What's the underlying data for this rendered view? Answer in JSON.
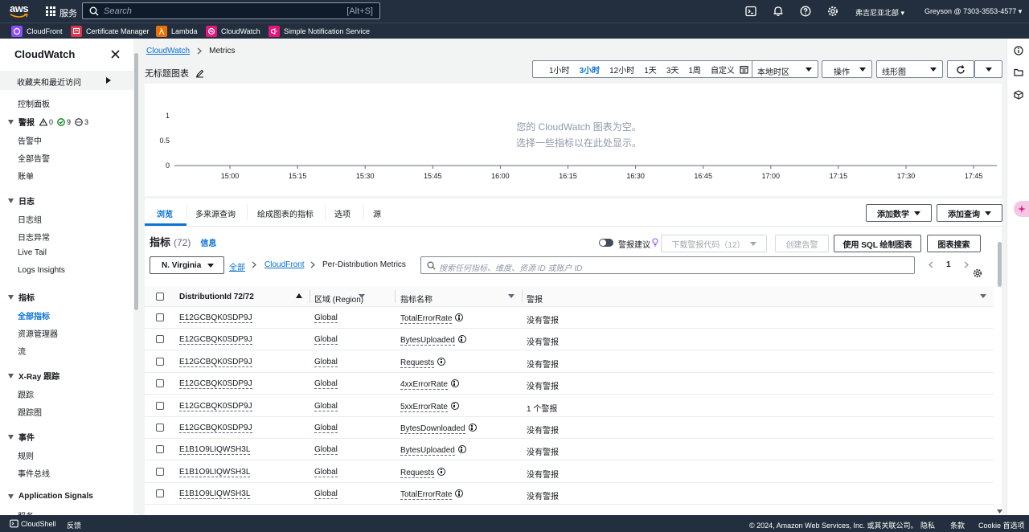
{
  "topbar": {
    "logo_text": "aws",
    "services_label": "服务",
    "search_placeholder": "Search",
    "search_shortcut": "[Alt+S]",
    "region": "弗吉尼亚北部",
    "account": "Greyson @ 7303-3553-4577"
  },
  "favorites": [
    {
      "label": "CloudFront",
      "color": "#8c4fff"
    },
    {
      "label": "Certificate Manager",
      "color": "#dd344c"
    },
    {
      "label": "Lambda",
      "color": "#ed7100"
    },
    {
      "label": "CloudWatch",
      "color": "#e7157b"
    },
    {
      "label": "Simple Notification Service",
      "color": "#e7157b"
    }
  ],
  "sidebar": {
    "title": "CloudWatch",
    "favorites_label": "收藏夹和最近访问",
    "dashboard": "控制面板",
    "alarms_section": "警报",
    "alarm_counts": {
      "alarm": "0",
      "ok": "9",
      "insufficient": "3"
    },
    "alarms_items": [
      "告警中",
      "全部告警",
      "账单"
    ],
    "logs_section": "日志",
    "logs_items": [
      "日志组",
      "日志异常",
      "Live Tail",
      "Logs Insights"
    ],
    "metrics_section": "指标",
    "metrics_items": [
      "全部指标",
      "资源管理器",
      "流"
    ],
    "xray_section": "X-Ray 跟踪",
    "xray_items": [
      "跟踪",
      "跟踪图"
    ],
    "events_section": "事件",
    "events_items": [
      "规则",
      "事件总线"
    ],
    "appsignals_section": "Application Signals",
    "appsignals_items": [
      "服务"
    ]
  },
  "breadcrumb": {
    "root": "CloudWatch",
    "current": "Metrics"
  },
  "graph": {
    "title": "无标题图表",
    "time_ranges": [
      "1小时",
      "3小时",
      "12小时",
      "1天",
      "3天",
      "1周",
      "自定义"
    ],
    "selected_range": "3小时",
    "timezone": "本地时区",
    "actions": "操作",
    "chart_type": "线形图",
    "empty_line1": "您的 CloudWatch 图表为空。",
    "empty_line2": "选择一些指标以在此处显示。"
  },
  "chart_data": {
    "type": "line",
    "title": "",
    "series": [],
    "x": [
      "15:00",
      "15:15",
      "15:30",
      "15:45",
      "16:00",
      "16:15",
      "16:30",
      "16:45",
      "17:00",
      "17:15",
      "17:30",
      "17:45"
    ],
    "y_ticks": [
      "1",
      "0.5",
      "0"
    ],
    "ylim": [
      0,
      1
    ],
    "grid": false
  },
  "tabs": [
    "浏览",
    "多来源查询",
    "绘成图表的指标",
    "选项",
    "源"
  ],
  "lower_buttons": {
    "add_math": "添加数学",
    "add_query": "添加查询"
  },
  "metrics": {
    "title": "指标",
    "count": "(72)",
    "info": "信息",
    "alarm_suggest": "警报建议",
    "download_code": "下载警报代码（12）",
    "create_alarm": "创建告警",
    "sql_graph": "使用 SQL 绘制图表",
    "graph_search": "图表搜索",
    "region_filter": "N. Virginia",
    "crumb_all": "全部",
    "crumb_ns": "CloudFront",
    "crumb_dim": "Per-Distribution Metrics",
    "search_placeholder": "搜索任何指标、维度、资源 ID 或账户 ID",
    "page": "1"
  },
  "table": {
    "headers": [
      "DistributionId 72/72",
      "区域 (Region)",
      "指标名称",
      "警报"
    ],
    "rows": [
      {
        "id": "E12GCBQK0SDP9J",
        "region": "Global",
        "metric": "TotalErrorRate",
        "alarm": "没有警报"
      },
      {
        "id": "E12GCBQK0SDP9J",
        "region": "Global",
        "metric": "BytesUploaded",
        "alarm": "没有警报"
      },
      {
        "id": "E12GCBQK0SDP9J",
        "region": "Global",
        "metric": "Requests",
        "alarm": "没有警报"
      },
      {
        "id": "E12GCBQK0SDP9J",
        "region": "Global",
        "metric": "4xxErrorRate",
        "alarm": "没有警报"
      },
      {
        "id": "E12GCBQK0SDP9J",
        "region": "Global",
        "metric": "5xxErrorRate",
        "alarm": "1 个警报"
      },
      {
        "id": "E12GCBQK0SDP9J",
        "region": "Global",
        "metric": "BytesDownloaded",
        "alarm": "没有警报"
      },
      {
        "id": "E1B1O9LIQWSH3L",
        "region": "Global",
        "metric": "BytesUploaded",
        "alarm": "没有警报"
      },
      {
        "id": "E1B1O9LIQWSH3L",
        "region": "Global",
        "metric": "Requests",
        "alarm": "没有警报"
      },
      {
        "id": "E1B1O9LIQWSH3L",
        "region": "Global",
        "metric": "TotalErrorRate",
        "alarm": "没有警报"
      }
    ]
  },
  "footer": {
    "cloudshell": "CloudShell",
    "feedback": "反馈",
    "copyright": "© 2024, Amazon Web Services, Inc. 或其关联公司。",
    "privacy": "隐私",
    "terms": "条款",
    "cookie": "Cookie 首选项"
  }
}
